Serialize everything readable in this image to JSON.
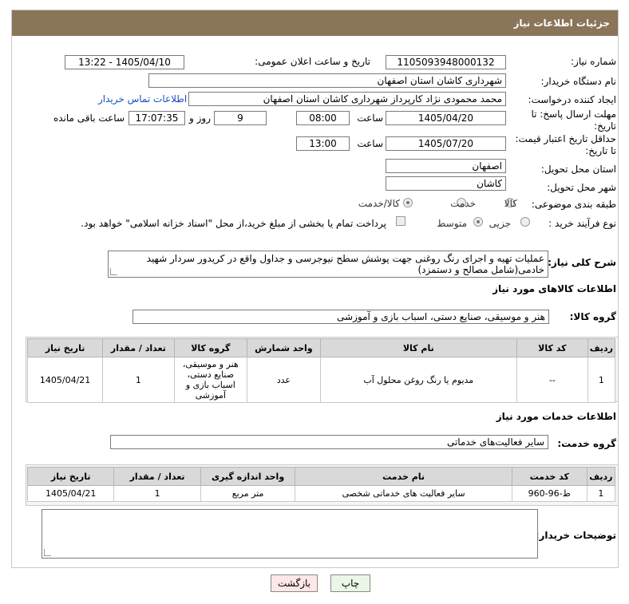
{
  "header": {
    "title": "جزئیات اطلاعات نیاز"
  },
  "fields": {
    "need_number_label": "شماره نیاز:",
    "need_number": "1105093948000132",
    "announce_label": "تاریخ و ساعت اعلان عمومی:",
    "announce_value": "1405/04/10 - 13:22",
    "buyer_org_label": "نام دستگاه خریدار:",
    "buyer_org": "شهرداری کاشان استان اصفهان",
    "creator_label": "ایجاد کننده درخواست:",
    "creator": "محمد محمودی نژاد کارپرداز شهرداری کاشان استان اصفهان",
    "contact_link": "اطلاعات تماس خریدار",
    "reply_deadline_label_1": "مهلت ارسال پاسخ: تا",
    "reply_deadline_label_2": "تاریخ:",
    "reply_date": "1405/04/20",
    "time_label": "ساعت",
    "reply_time": "08:00",
    "days": "9",
    "days_label": "روز و",
    "remaining_time": "17:07:35",
    "remaining_label": "ساعت باقی مانده",
    "price_validity_label_1": "حداقل تاریخ اعتبار قیمت:",
    "price_validity_label_2": "تا تاریخ:",
    "price_date": "1405/07/20",
    "price_time": "13:00",
    "province_label": "استان محل تحویل:",
    "province": "اصفهان",
    "city_label": "شهر محل تحویل:",
    "city": "کاشان",
    "category_label": "طبقه بندی موضوعی:",
    "category_options": [
      "کالا",
      "خدمت",
      "کالا/خدمت"
    ],
    "process_label": "نوع فرآیند خرید :",
    "process_options": [
      "جزیی",
      "متوسط"
    ],
    "payment_note": "پرداخت تمام یا بخشی از مبلغ خرید،از محل \"اسناد خزانه اسلامی\" خواهد بود."
  },
  "description": {
    "label": "شرح کلی نیاز:",
    "text": "عملیات تهیه و اجرای رنگ روغنی جهت پوشش سطح نیوجرسی و جداول واقع در کریدور سردار شهید خادمی(شامل مصالح و دستمزد)"
  },
  "goods": {
    "section_title": "اطلاعات کالاهای مورد نیاز",
    "group_label": "گروه کالا:",
    "group_value": "هنر و موسیقی، صنایع دستی، اسباب بازی و آموزشی",
    "columns": [
      "ردیف",
      "کد کالا",
      "نام کالا",
      "واحد شمارش",
      "گروه کالا",
      "تعداد / مقدار",
      "تاریخ نیاز"
    ],
    "rows": [
      [
        "1",
        "--",
        "مدیوم یا رنگ روغن محلول آب",
        "عدد",
        "هنر و موسیقی، صنایع دستی، اسباب بازی و آموزشی",
        "1",
        "1405/04/21"
      ]
    ]
  },
  "services": {
    "section_title": "اطلاعات خدمات مورد نیاز",
    "group_label": "گروه خدمت:",
    "group_value": "سایر فعالیت‌های خدماتی",
    "columns": [
      "ردیف",
      "کد خدمت",
      "نام خدمت",
      "واحد اندازه گیری",
      "تعداد / مقدار",
      "تاریخ نیاز"
    ],
    "rows": [
      [
        "1",
        "ط-96-960",
        "سایر فعالیت های خدماتی شخصی",
        "متر مربع",
        "1",
        "1405/04/21"
      ]
    ]
  },
  "buyer_notes": {
    "label": "توضیحات خریدار:"
  },
  "buttons": {
    "print": "چاپ",
    "back": "بازگشت"
  },
  "colors": {
    "header": "#8a7559",
    "back_button": "#fde7e7",
    "print_button": "#eaf7e6"
  }
}
